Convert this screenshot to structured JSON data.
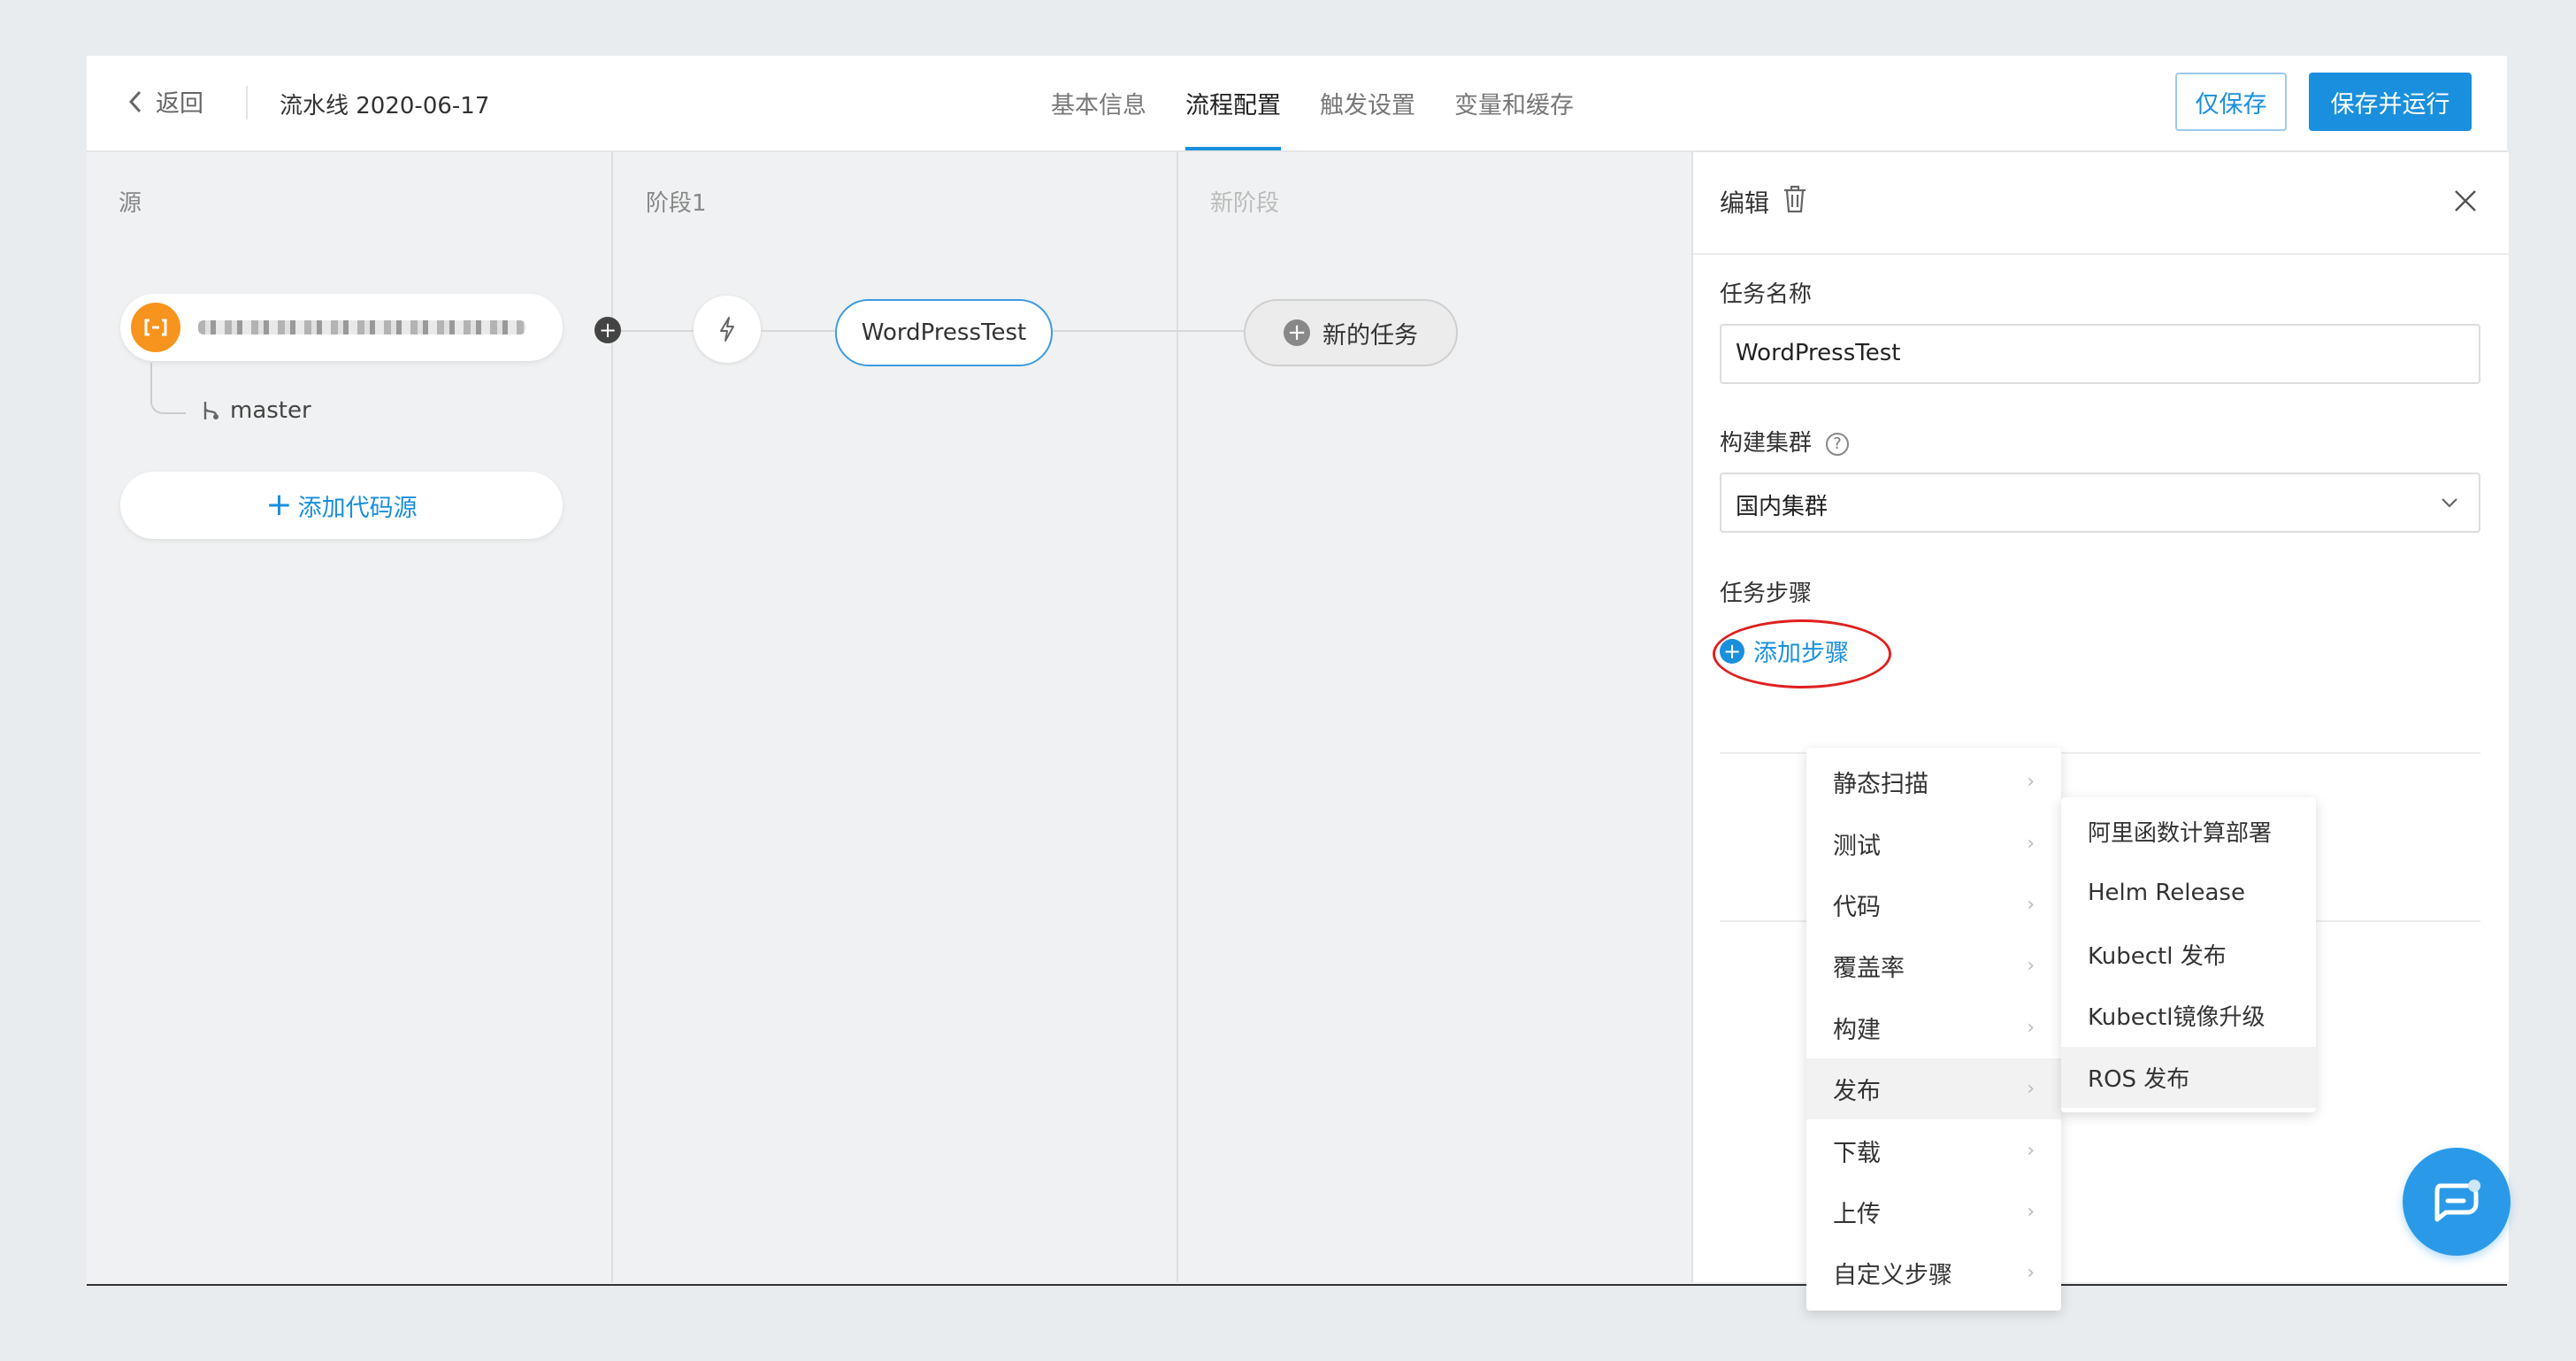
{
  "header": {
    "back_label": "返回",
    "pipeline_name": "流水线 2020-06-17",
    "tabs": [
      {
        "label": "基本信息",
        "active": false
      },
      {
        "label": "流程配置",
        "active": true
      },
      {
        "label": "触发设置",
        "active": false
      },
      {
        "label": "变量和缓存",
        "active": false
      }
    ],
    "save_only_label": "仅保存",
    "save_run_label": "保存并运行"
  },
  "columns": {
    "source_title": "源",
    "stage1_title": "阶段1",
    "new_stage_title": "新阶段"
  },
  "source": {
    "branch": "master",
    "add_source_label": "添加代码源"
  },
  "stage": {
    "task_name": "WordPressTest",
    "new_task_label": "新的任务"
  },
  "panel": {
    "title": "编辑",
    "task_name_label": "任务名称",
    "task_name_value": "WordPressTest",
    "cluster_label": "构建集群",
    "cluster_value": "国内集群",
    "steps_label": "任务步骤",
    "add_step_label": "添加步骤"
  },
  "step_menu": {
    "items": [
      {
        "label": "静态扫描",
        "active": false
      },
      {
        "label": "测试",
        "active": false
      },
      {
        "label": "代码",
        "active": false
      },
      {
        "label": "覆盖率",
        "active": false
      },
      {
        "label": "构建",
        "active": false
      },
      {
        "label": "发布",
        "active": true
      },
      {
        "label": "下载",
        "active": false
      },
      {
        "label": "上传",
        "active": false
      },
      {
        "label": "自定义步骤",
        "active": false
      }
    ],
    "submenu": [
      {
        "label": "阿里函数计算部署",
        "active": false
      },
      {
        "label": "Helm Release",
        "active": false
      },
      {
        "label": "Kubectl 发布",
        "active": false
      },
      {
        "label": "Kubectl镜像升级",
        "active": false
      },
      {
        "label": "ROS 发布",
        "active": true
      }
    ]
  },
  "colors": {
    "accent": "#1a8fdd",
    "source_icon": "#f7941d",
    "highlight_ellipse": "#e02020"
  },
  "icons": {
    "back": "chevron-left-icon",
    "delete": "trash-icon",
    "close": "close-icon",
    "branch": "git-branch-icon",
    "trigger": "lightning-icon",
    "source": "code-source-icon",
    "chat": "chat-icon"
  }
}
